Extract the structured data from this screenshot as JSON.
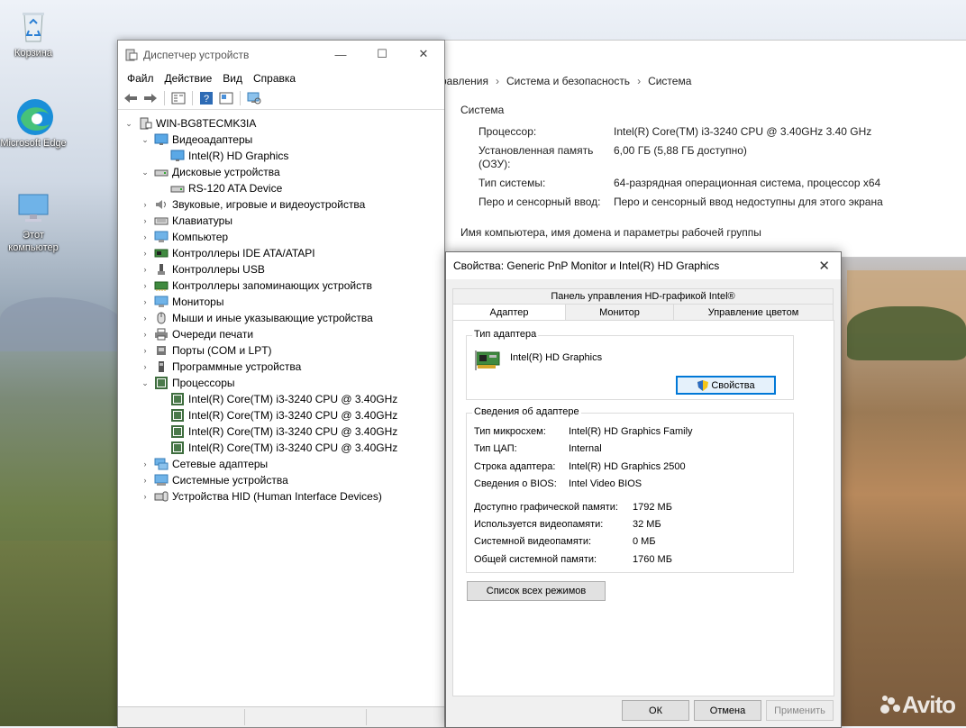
{
  "desktop": {
    "icons": [
      {
        "label": "Корзина"
      },
      {
        "label": "Microsoft Edge"
      },
      {
        "label": "Этот компьютер"
      }
    ],
    "watermark": "Avito"
  },
  "system_window": {
    "breadcrumb": [
      "равления",
      "Система и безопасность",
      "Система"
    ],
    "section": "Система",
    "rows": [
      {
        "k": "Процессор:",
        "v": "Intel(R) Core(TM) i3-3240 CPU @ 3.40GHz   3.40 GHz"
      },
      {
        "k": "Установленная память (ОЗУ):",
        "v": "6,00 ГБ (5,88 ГБ доступно)"
      },
      {
        "k": "Тип системы:",
        "v": "64-разрядная операционная система, процессор x64"
      },
      {
        "k": "Перо и сенсорный ввод:",
        "v": "Перо и сенсорный ввод недоступны для этого экрана"
      }
    ],
    "bottom": "Имя компьютера, имя домена и параметры рабочей группы"
  },
  "device_manager": {
    "title": "Диспетчер устройств",
    "menu": [
      "Файл",
      "Действие",
      "Вид",
      "Справка"
    ],
    "root": "WIN-BG8TECMK3IA",
    "tree": [
      {
        "label": "Видеоадаптеры",
        "level": 1,
        "expanded": true,
        "icon": "display"
      },
      {
        "label": "Intel(R) HD Graphics",
        "level": 2,
        "icon": "display"
      },
      {
        "label": "Дисковые устройства",
        "level": 1,
        "expanded": true,
        "icon": "disk"
      },
      {
        "label": "RS-120 ATA Device",
        "level": 2,
        "icon": "disk"
      },
      {
        "label": "Звуковые, игровые и видеоустройства",
        "level": 1,
        "icon": "sound"
      },
      {
        "label": "Клавиатуры",
        "level": 1,
        "icon": "keyboard"
      },
      {
        "label": "Компьютер",
        "level": 1,
        "icon": "monitor"
      },
      {
        "label": "Контроллеры IDE ATA/ATAPI",
        "level": 1,
        "icon": "ide"
      },
      {
        "label": "Контроллеры USB",
        "level": 1,
        "icon": "usb"
      },
      {
        "label": "Контроллеры запоминающих устройств",
        "level": 1,
        "icon": "storage"
      },
      {
        "label": "Мониторы",
        "level": 1,
        "icon": "monitor"
      },
      {
        "label": "Мыши и иные указывающие устройства",
        "level": 1,
        "icon": "mouse"
      },
      {
        "label": "Очереди печати",
        "level": 1,
        "icon": "printer"
      },
      {
        "label": "Порты (COM и LPT)",
        "level": 1,
        "icon": "port"
      },
      {
        "label": "Программные устройства",
        "level": 1,
        "icon": "software"
      },
      {
        "label": "Процессоры",
        "level": 1,
        "expanded": true,
        "icon": "cpu"
      },
      {
        "label": "Intel(R) Core(TM) i3-3240 CPU @ 3.40GHz",
        "level": 2,
        "icon": "cpu"
      },
      {
        "label": "Intel(R) Core(TM) i3-3240 CPU @ 3.40GHz",
        "level": 2,
        "icon": "cpu"
      },
      {
        "label": "Intel(R) Core(TM) i3-3240 CPU @ 3.40GHz",
        "level": 2,
        "icon": "cpu"
      },
      {
        "label": "Intel(R) Core(TM) i3-3240 CPU @ 3.40GHz",
        "level": 2,
        "icon": "cpu"
      },
      {
        "label": "Сетевые адаптеры",
        "level": 1,
        "icon": "network"
      },
      {
        "label": "Системные устройства",
        "level": 1,
        "icon": "system"
      },
      {
        "label": "Устройства HID (Human Interface Devices)",
        "level": 1,
        "icon": "hid"
      }
    ]
  },
  "dialog": {
    "title": "Свойства: Generic PnP Monitor и Intel(R) HD Graphics",
    "top_tab": "Панель управления HD-графикой Intel®",
    "tabs": [
      "Адаптер",
      "Монитор",
      "Управление цветом"
    ],
    "adapter_type": {
      "label": "Тип адаптера",
      "name": "Intel(R) HD Graphics",
      "properties_button": "Свойства"
    },
    "adapter_info": {
      "label": "Сведения об адаптере",
      "rows": [
        {
          "k": "Тип микросхем:",
          "v": "Intel(R) HD Graphics Family"
        },
        {
          "k": "Тип ЦАП:",
          "v": "Internal"
        },
        {
          "k": "Строка адаптера:",
          "v": "Intel(R) HD Graphics 2500"
        },
        {
          "k": "Сведения о BIOS:",
          "v": "Intel Video BIOS"
        }
      ],
      "memory": [
        {
          "k": "Доступно графической памяти:",
          "v": "1792 МБ"
        },
        {
          "k": "Используется видеопамяти:",
          "v": "32 МБ"
        },
        {
          "k": "Системной видеопамяти:",
          "v": "0 МБ"
        },
        {
          "k": "Общей системной памяти:",
          "v": "1760 МБ"
        }
      ]
    },
    "list_modes_button": "Список всех режимов",
    "ok": "ОК",
    "cancel": "Отмена",
    "apply": "Применить"
  }
}
